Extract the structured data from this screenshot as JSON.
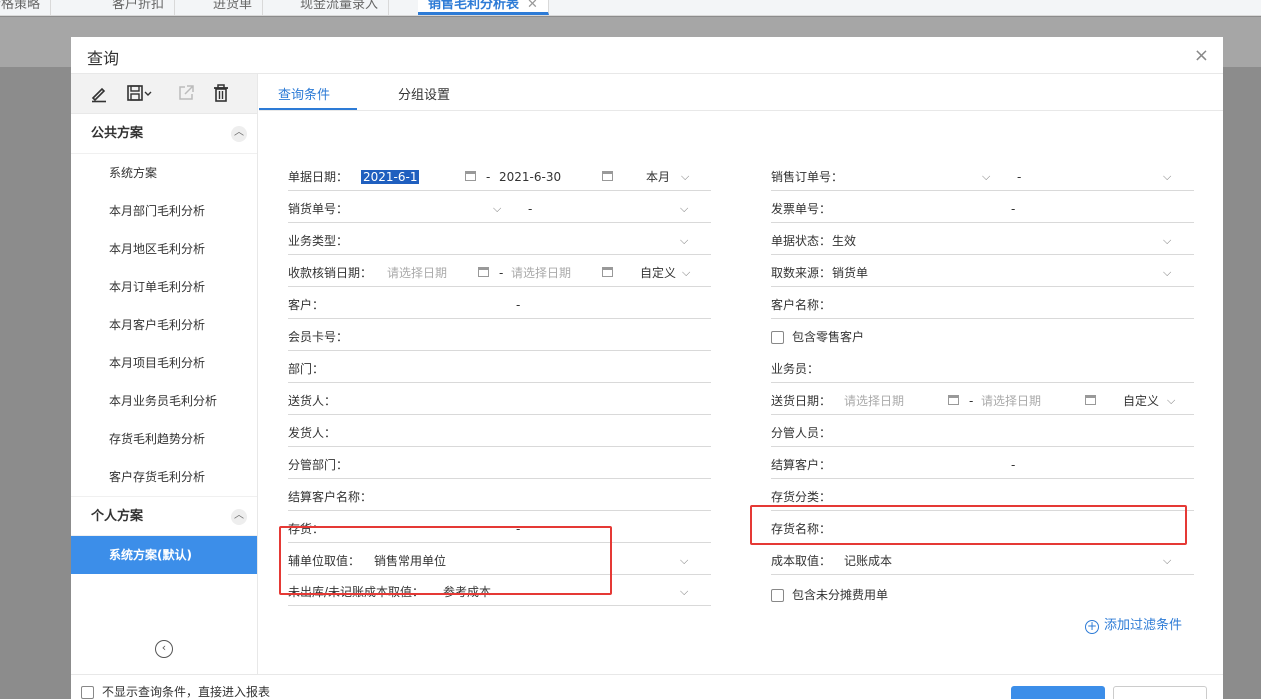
{
  "app_tabs": [
    {
      "label": "价格策略",
      "active": false
    },
    {
      "label": "客户折扣",
      "active": false
    },
    {
      "label": "进货单",
      "active": false
    },
    {
      "label": "现金流量录入",
      "active": false
    },
    {
      "label": "销售毛利分析表",
      "active": true
    }
  ],
  "dialog": {
    "title": "查询",
    "close": "×"
  },
  "sidebar": {
    "toolbar": [
      "edit-icon",
      "save-icon",
      "export-icon",
      "delete-icon"
    ],
    "public_title": "公共方案",
    "public_items": [
      "系统方案",
      "本月部门毛利分析",
      "本月地区毛利分析",
      "本月订单毛利分析",
      "本月客户毛利分析",
      "本月项目毛利分析",
      "本月业务员毛利分析",
      "存货毛利趋势分析",
      "客户存货毛利分析"
    ],
    "personal_title": "个人方案",
    "personal_items": [
      "系统方案(默认)"
    ],
    "collapse_glyph": "‹"
  },
  "tabs": [
    "查询条件",
    "分组设置"
  ],
  "left_fields": {
    "doc_date": {
      "label": "单据日期：",
      "from": "2021-6-1",
      "to": "2021-6-30",
      "range": "本月"
    },
    "sales_no": {
      "label": "销货单号：",
      "sep": "-"
    },
    "biz_type": {
      "label": "业务类型："
    },
    "recv_date": {
      "label": "收款核销日期：",
      "from_ph": "请选择日期",
      "to_ph": "请选择日期",
      "range": "自定义"
    },
    "customer": {
      "label": "客户：",
      "sep": "-"
    },
    "member_card": {
      "label": "会员卡号："
    },
    "dept": {
      "label": "部门："
    },
    "deliverer": {
      "label": "送货人："
    },
    "shipper": {
      "label": "发货人："
    },
    "mgr_dept": {
      "label": "分管部门："
    },
    "settle_cust_name": {
      "label": "结算客户名称："
    },
    "inventory": {
      "label": "存货：",
      "sep": "-"
    },
    "aux_unit": {
      "label": "辅单位取值：",
      "value": "销售常用单位"
    },
    "unshipped_cost": {
      "label": "未出库/未记账成本取值：",
      "value": "参考成本"
    }
  },
  "right_fields": {
    "sales_order_no": {
      "label": "销售订单号：",
      "sep": "-"
    },
    "invoice_no": {
      "label": "发票单号：",
      "sep": "-"
    },
    "doc_status": {
      "label": "单据状态：",
      "value": "生效"
    },
    "data_source": {
      "label": "取数来源：",
      "value": "销货单"
    },
    "cust_name": {
      "label": "客户名称："
    },
    "include_retail": {
      "label": "包含零售客户"
    },
    "salesman": {
      "label": "业务员："
    },
    "delivery_date": {
      "label": "送货日期：",
      "from_ph": "请选择日期",
      "to_ph": "请选择日期",
      "range": "自定义"
    },
    "mgr_person": {
      "label": "分管人员："
    },
    "settle_cust": {
      "label": "结算客户：",
      "sep": "-"
    },
    "inv_category": {
      "label": "存货分类："
    },
    "inv_name": {
      "label": "存货名称："
    },
    "cost_value": {
      "label": "成本取值：",
      "value": "记账成本"
    },
    "include_unallocated": {
      "label": "包含未分摊费用单"
    }
  },
  "add_filter": "添加过滤条件",
  "footer": {
    "skip_query": "不显示查询条件，直接进入报表"
  },
  "colors": {
    "accent": "#2d7bd6",
    "active_bg": "#3c8ee9",
    "highlight_box": "#e53935"
  }
}
